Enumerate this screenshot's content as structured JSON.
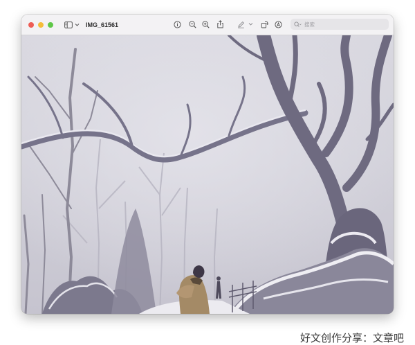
{
  "window": {
    "title": "IMG_61561"
  },
  "toolbar": {
    "tools": [
      "info-icon",
      "zoom-out-icon",
      "zoom-in-icon",
      "share-icon",
      "markup-pen-icon",
      "chevron-down-icon",
      "rotate-icon",
      "annotate-icon"
    ],
    "search_placeholder": "搜索"
  },
  "photo": {
    "subject": "snowy-forest-woman-photo"
  },
  "watermark": "好文创作分享：文章吧",
  "colors": {
    "close": "#ee5d55",
    "minimize": "#f4bd3a",
    "zoom": "#5fc748"
  }
}
